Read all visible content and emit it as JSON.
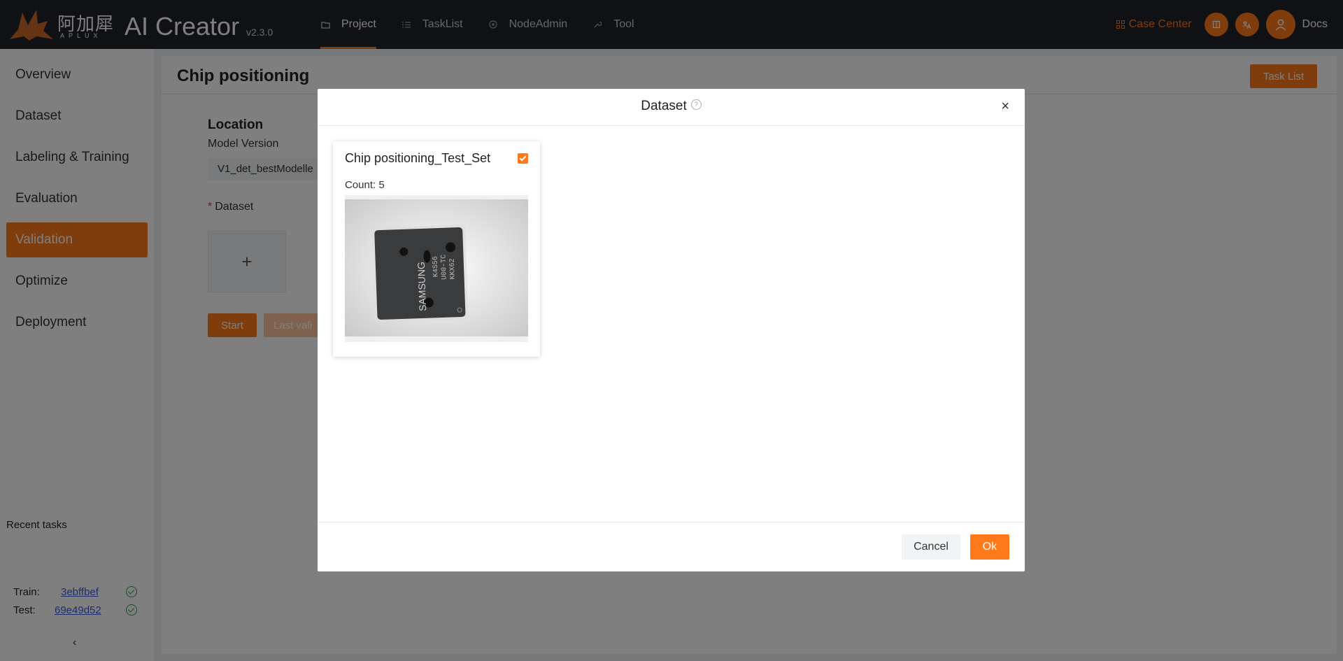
{
  "brand": {
    "logo_cn": "阿加犀",
    "logo_en": "APLUX",
    "app_title": "AI Creator",
    "version": "v2.3.0",
    "accent_color": "#ff7a1a"
  },
  "nav": {
    "items": [
      {
        "label": "Project",
        "icon": "folder-icon",
        "active": true
      },
      {
        "label": "TaskList",
        "icon": "list-icon",
        "active": false
      },
      {
        "label": "NodeAdmin",
        "icon": "node-icon",
        "active": false
      },
      {
        "label": "Tool",
        "icon": "wrench-icon",
        "active": false
      }
    ]
  },
  "topright": {
    "case_center": "Case Center",
    "docs": "Docs"
  },
  "sidebar": {
    "items": [
      {
        "label": "Overview",
        "active": false
      },
      {
        "label": "Dataset",
        "active": false
      },
      {
        "label": "Labeling & Training",
        "active": false
      },
      {
        "label": "Evaluation",
        "active": false
      },
      {
        "label": "Validation",
        "active": true
      },
      {
        "label": "Optimize",
        "active": false
      },
      {
        "label": "Deployment",
        "active": false
      }
    ],
    "recent_title": "Recent tasks",
    "recent": [
      {
        "label": "Train:",
        "id": "3ebffbef",
        "status": "success"
      },
      {
        "label": "Test:",
        "id": "69e49d52",
        "status": "success"
      }
    ],
    "collapse_glyph": "‹"
  },
  "main": {
    "title": "Chip positioning",
    "task_list_button": "Task List",
    "location_title": "Location",
    "model_version_label": "Model Version",
    "model_version_value": "V1_det_bestModelle",
    "dataset_label": "Dataset",
    "dataset_required": "*",
    "add_glyph": "+",
    "start_button": "Start",
    "last_button": "Last vali"
  },
  "modal": {
    "title": "Dataset",
    "help_glyph": "?",
    "close_glyph": "×",
    "cards": [
      {
        "title": "Chip positioning_Test_Set",
        "count_label": "Count: 5",
        "checked": true,
        "chip_brand": "SAMSUNG"
      }
    ],
    "cancel_button": "Cancel",
    "ok_button": "Ok"
  }
}
